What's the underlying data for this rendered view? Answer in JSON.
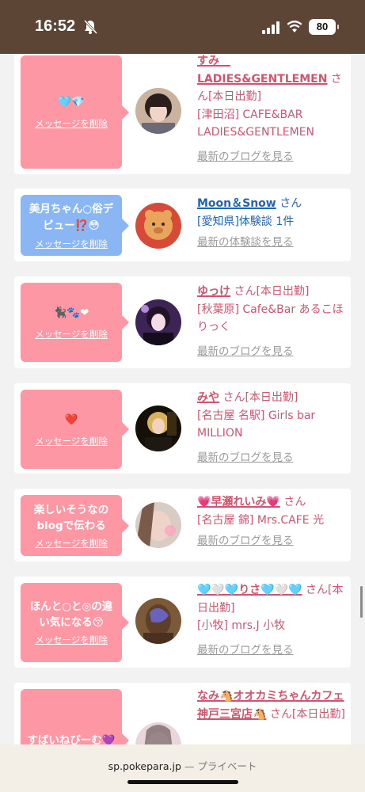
{
  "status": {
    "time": "16:52",
    "battery": "80"
  },
  "cards": [
    {
      "bubble_message": "🩵💎",
      "delete_label": "メッセージを削除",
      "name": "すみ　LADIES&GENTLEMEN",
      "suffix": "さん[本日出勤]",
      "sub": "[津田沼] CAFE&BAR LADIES&GENTLEMEN",
      "link": "最新のブログを見る",
      "color": "#fd97a4"
    },
    {
      "bubble_message": "美月ちゃん○俗デビュー⁉️😳",
      "delete_label": "メッセージを削除",
      "name": "Moon＆Snow",
      "suffix": "さん",
      "sub": "[愛知県]体験談 1件",
      "link": "最新の体験談を見る",
      "color": "#8ab7f3"
    },
    {
      "bubble_message": "🐈‍⬛🐾❤",
      "delete_label": "メッセージを削除",
      "name": "ゆっけ",
      "suffix": "さん[本日出勤]",
      "sub": "[秋葉原] Cafe&Bar あるこほりっく",
      "link": "最新のブログを見る",
      "color": "#fd97a4"
    },
    {
      "bubble_message": "❤️",
      "delete_label": "メッセージを削除",
      "name": "みや",
      "suffix": "さん[本日出勤]",
      "sub": "[名古屋 名駅] Girls bar MILLION",
      "link": "最新のブログを見る",
      "color": "#fd97a4"
    },
    {
      "bubble_message": "楽しいそうなのblogで伝わる",
      "delete_label": "メッセージを削除",
      "name": "💗早瀬れいみ💗",
      "suffix": "さん",
      "sub": "[名古屋 錦] Mrs.CAFE 光",
      "link": "最新のブログを見る",
      "color": "#fd97a4"
    },
    {
      "bubble_message": "ほんと○と◎の違い気になる😚",
      "delete_label": "メッセージを削除",
      "name": "🩵🤍🩵りさ🩵🤍🩵",
      "suffix": "さん[本日出勤]",
      "sub": "[小牧] mrs.J 小牧",
      "link": "最新のブログを見る",
      "color": "#fd97a4"
    },
    {
      "bubble_message": "すばいねびーむ💜",
      "delete_label": "",
      "name": "なみ🐴オオカミちゃんカフェ神戸三宮店🐴",
      "suffix": "さん[本日出勤]",
      "sub": "",
      "link": "",
      "color": "#fd97a4"
    }
  ],
  "bottom": {
    "domain": "sp.pokepara.jp",
    "separator": "—",
    "private": "プライベート"
  }
}
